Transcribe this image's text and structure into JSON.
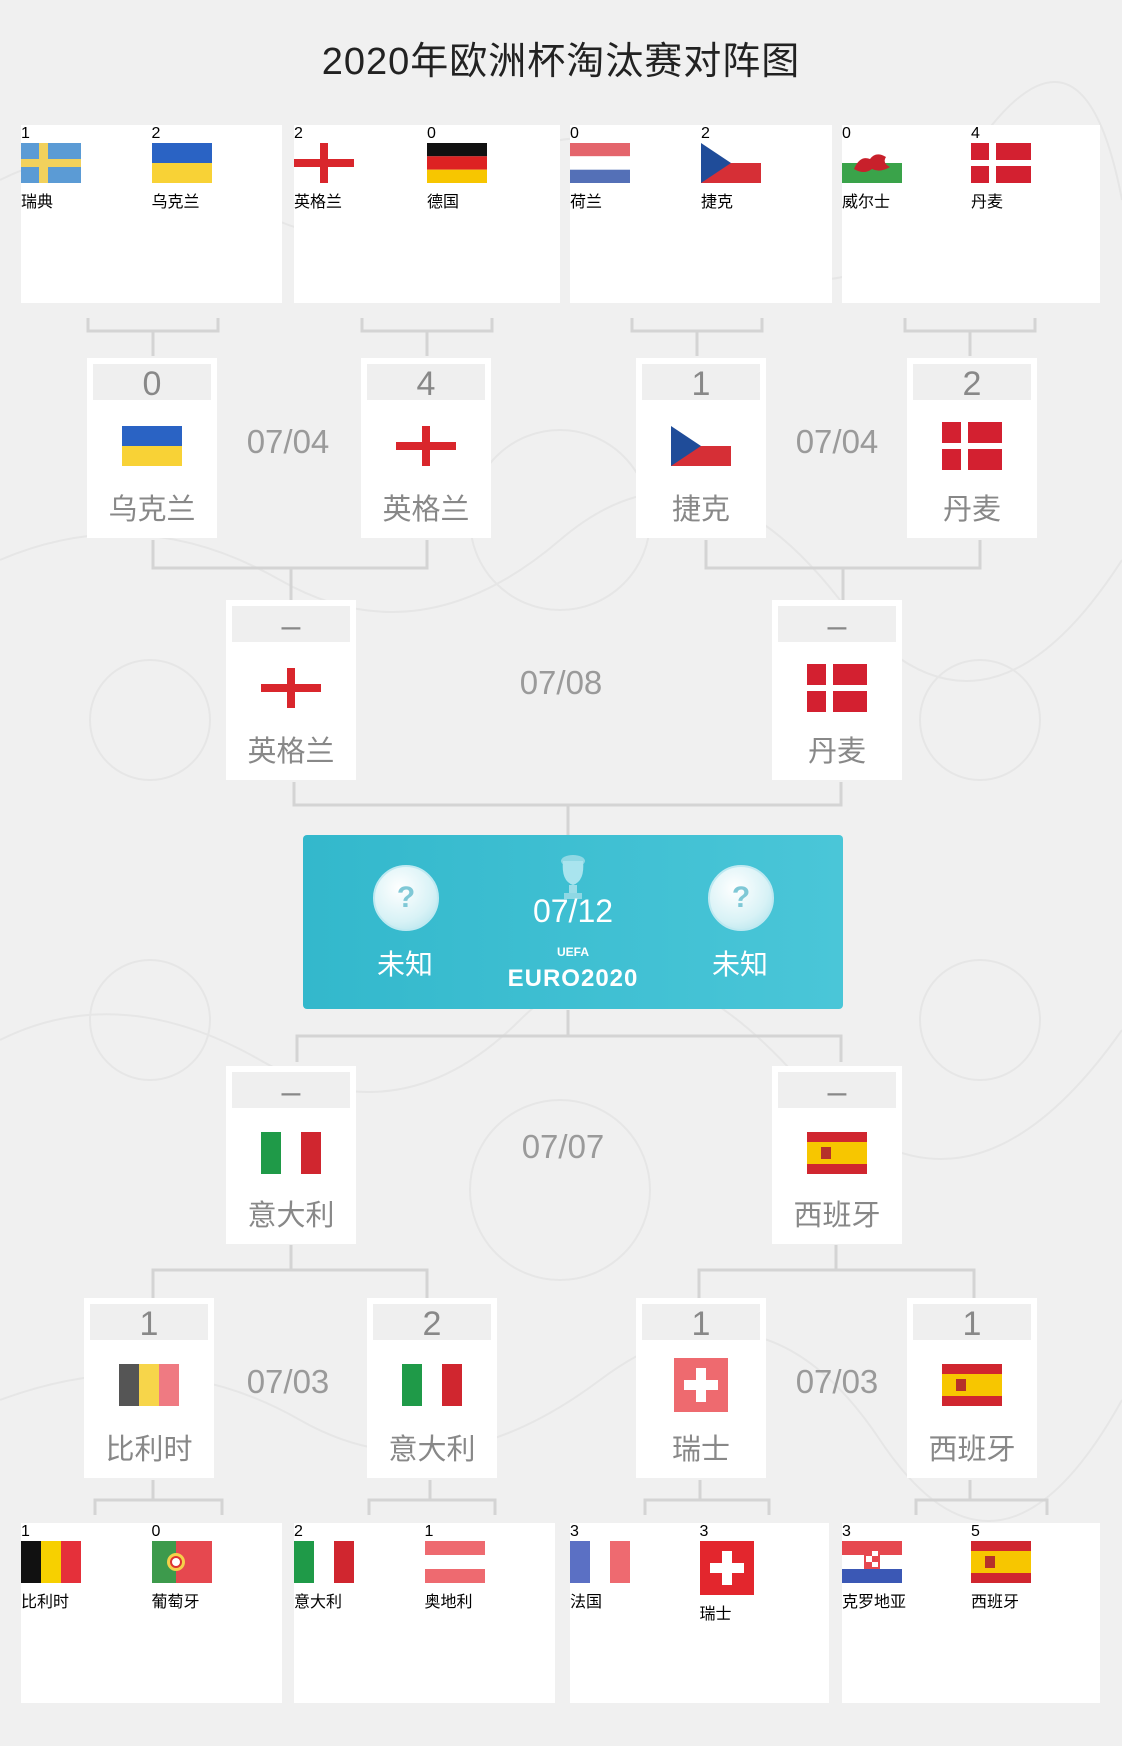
{
  "title": "2020年欧洲杯淘汰赛对阵图",
  "colors": {
    "final_bg": "#3fbfd2",
    "card_bg": "#ffffff",
    "page_bg": "#f0f0f0"
  },
  "round16_top": [
    {
      "left": {
        "score": "1",
        "team": "瑞典",
        "flag": "sweden-flag"
      },
      "right": {
        "score": "2",
        "team": "乌克兰",
        "flag": "ukraine-flag"
      }
    },
    {
      "left": {
        "score": "2",
        "team": "英格兰",
        "flag": "england-flag"
      },
      "right": {
        "score": "0",
        "team": "德国",
        "flag": "germany-flag"
      }
    },
    {
      "left": {
        "score": "0",
        "team": "荷兰",
        "flag": "netherlands-flag"
      },
      "right": {
        "score": "2",
        "team": "捷克",
        "flag": "czech-flag"
      }
    },
    {
      "left": {
        "score": "0",
        "team": "威尔士",
        "flag": "wales-flag"
      },
      "right": {
        "score": "4",
        "team": "丹麦",
        "flag": "denmark-flag"
      }
    }
  ],
  "quarter_top": {
    "left_date": "07/04",
    "right_date": "07/04",
    "teams": [
      {
        "score": "0",
        "team": "乌克兰",
        "flag": "ukraine-flag"
      },
      {
        "score": "4",
        "team": "英格兰",
        "flag": "england-flag"
      },
      {
        "score": "1",
        "team": "捷克",
        "flag": "czech-flag"
      },
      {
        "score": "2",
        "team": "丹麦",
        "flag": "denmark-flag"
      }
    ]
  },
  "semi_top": {
    "date": "07/08",
    "teams": [
      {
        "score": "–",
        "team": "英格兰",
        "flag": "england-flag"
      },
      {
        "score": "–",
        "team": "丹麦",
        "flag": "denmark-flag"
      }
    ]
  },
  "final": {
    "date": "07/12",
    "left_team": "未知",
    "right_team": "未知",
    "ball_mark": "?",
    "logo_text": "EURO2020",
    "logo_top": "UEFA"
  },
  "semi_bottom": {
    "date": "07/07",
    "teams": [
      {
        "score": "–",
        "team": "意大利",
        "flag": "italy-flag"
      },
      {
        "score": "–",
        "team": "西班牙",
        "flag": "spain-flag"
      }
    ]
  },
  "quarter_bottom": {
    "left_date": "07/03",
    "right_date": "07/03",
    "teams": [
      {
        "score": "1",
        "team": "比利时",
        "flag": "belgium-flag"
      },
      {
        "score": "2",
        "team": "意大利",
        "flag": "italy-flag"
      },
      {
        "score": "1",
        "team": "瑞士",
        "flag": "switzerland-flag"
      },
      {
        "score": "1",
        "team": "西班牙",
        "flag": "spain-flag"
      }
    ]
  },
  "round16_bottom": [
    {
      "left": {
        "score": "1",
        "team": "比利时",
        "flag": "belgium-flag"
      },
      "right": {
        "score": "0",
        "team": "葡萄牙",
        "flag": "portugal-flag"
      }
    },
    {
      "left": {
        "score": "2",
        "team": "意大利",
        "flag": "italy-flag"
      },
      "right": {
        "score": "1",
        "team": "奥地利",
        "flag": "austria-flag"
      }
    },
    {
      "left": {
        "score": "3",
        "team": "法国",
        "flag": "france-flag"
      },
      "right": {
        "score": "3",
        "team": "瑞士",
        "flag": "switzerland-flag"
      }
    },
    {
      "left": {
        "score": "3",
        "team": "克罗地亚",
        "flag": "croatia-flag"
      },
      "right": {
        "score": "5",
        "team": "西班牙",
        "flag": "spain-flag"
      }
    }
  ]
}
